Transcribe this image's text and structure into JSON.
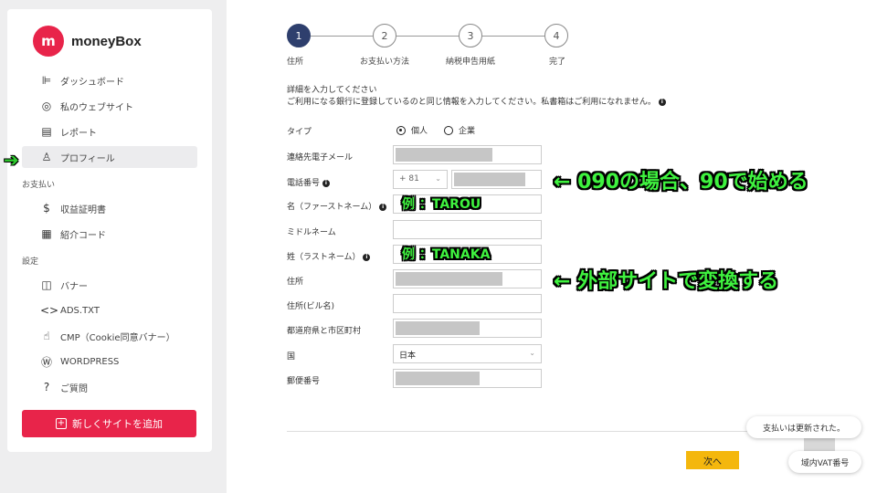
{
  "app": {
    "logo_text": "moneyBox",
    "logo_mark": "m"
  },
  "sidebar": {
    "items": [
      {
        "label": "ダッシュボード",
        "icon": "dashboard-icon",
        "glyph": "⊫"
      },
      {
        "label": "私のウェブサイト",
        "icon": "compass-icon",
        "glyph": "◎"
      },
      {
        "label": "レポート",
        "icon": "report-icon",
        "glyph": "▤"
      },
      {
        "label": "プロフィール",
        "icon": "user-icon",
        "glyph": "♙"
      }
    ],
    "section_payment": "お支払い",
    "payment_items": [
      {
        "label": "収益証明書",
        "icon": "dollar-icon",
        "glyph": "$"
      },
      {
        "label": "紹介コード",
        "icon": "gift-icon",
        "glyph": "▦"
      }
    ],
    "section_settings": "設定",
    "settings_items": [
      {
        "label": "バナー",
        "icon": "banner-icon",
        "glyph": "◫"
      },
      {
        "label": "ADS.TXT",
        "icon": "code-icon",
        "glyph": "<>"
      },
      {
        "label": "CMP（Cookie同意バナー）",
        "icon": "thumbs-up-icon",
        "glyph": "☝"
      },
      {
        "label": "WORDPRESS",
        "icon": "wordpress-icon",
        "glyph": "Ⓦ"
      },
      {
        "label": "ご質問",
        "icon": "question-icon",
        "glyph": "?"
      }
    ],
    "add_site_label": "新しくサイトを追加"
  },
  "stepper": {
    "steps": [
      {
        "num": "1",
        "label": "住所"
      },
      {
        "num": "2",
        "label": "お支払い方法"
      },
      {
        "num": "3",
        "label": "納税申告用紙"
      },
      {
        "num": "4",
        "label": "完了"
      }
    ]
  },
  "form": {
    "intro_line1": "詳細を入力してください",
    "intro_line2": "ご利用になる銀行に登録しているのと同じ情報を入力してください。私書箱はご利用になれません。",
    "type_label": "タイプ",
    "type_option_personal": "個人",
    "type_option_company": "企業",
    "email_label": "連絡先電子メール",
    "phone_label": "電話番号",
    "phone_prefix": "+ 81",
    "first_name_label": "名（ファーストネーム）",
    "middle_name_label": "ミドルネーム",
    "last_name_label": "姓（ラストネーム）",
    "address_label": "住所",
    "address2_label": "住所(ビル名)",
    "city_label": "都道府県と市区町村",
    "country_label": "国",
    "country_value": "日本",
    "postal_label": "郵便番号"
  },
  "actions": {
    "next_label": "次へ"
  },
  "notifications": {
    "toast": "支払いは更新された。",
    "vat_button": "域内VAT番号"
  },
  "annotations": {
    "phone_note": "← 090の場合、90で始める",
    "first_name_example": "例 ：TAROU",
    "last_name_example": "例 ：TANAKA",
    "address_note": "← 外部サイトで変換する",
    "sidebar_arrow": "➔"
  },
  "colors": {
    "brand": "#e8244a",
    "step_active": "#2e3f6d",
    "next_button": "#f4b70d",
    "annotation": "#3ff23f"
  }
}
